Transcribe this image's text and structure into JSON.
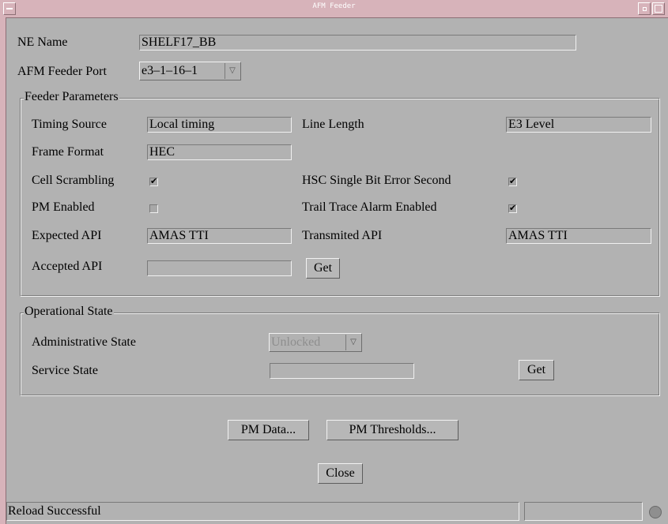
{
  "window": {
    "title": "AFM Feeder"
  },
  "ne_name": {
    "label": "NE Name",
    "value": "SHELF17_BB"
  },
  "feeder_port": {
    "label": "AFM Feeder Port",
    "value": "e3–1–16–1",
    "arrow": "▽"
  },
  "feeder_params": {
    "legend": "Feeder Parameters",
    "timing_source": {
      "label": "Timing Source",
      "value": "Local timing"
    },
    "line_length": {
      "label": "Line Length",
      "value": "E3 Level"
    },
    "frame_format": {
      "label": "Frame Format",
      "value": "HEC"
    },
    "cell_scrambling": {
      "label": "Cell Scrambling",
      "checked": true,
      "mark": "✔"
    },
    "hsc_single_bit": {
      "label": "HSC Single Bit Error Second",
      "checked": true,
      "mark": "✔"
    },
    "pm_enabled": {
      "label": "PM Enabled",
      "checked": false,
      "mark": ""
    },
    "trail_trace": {
      "label": "Trail Trace Alarm Enabled",
      "checked": true,
      "mark": "✔"
    },
    "expected_api": {
      "label": "Expected API",
      "value": "AMAS TTI"
    },
    "transmitted_api": {
      "label": "Transmited API",
      "value": "AMAS TTI"
    },
    "accepted_api": {
      "label": "Accepted API",
      "value": ""
    },
    "get_button": "Get"
  },
  "operational_state": {
    "legend": "Operational State",
    "admin_state": {
      "label": "Administrative State",
      "value": "Unlocked",
      "arrow": "▽"
    },
    "service_state": {
      "label": "Service State",
      "value": ""
    },
    "get_button": "Get"
  },
  "buttons": {
    "pm_data": "PM Data...",
    "pm_thresholds": "PM Thresholds...",
    "close": "Close"
  },
  "statusbar": {
    "message": "Reload Successful"
  }
}
